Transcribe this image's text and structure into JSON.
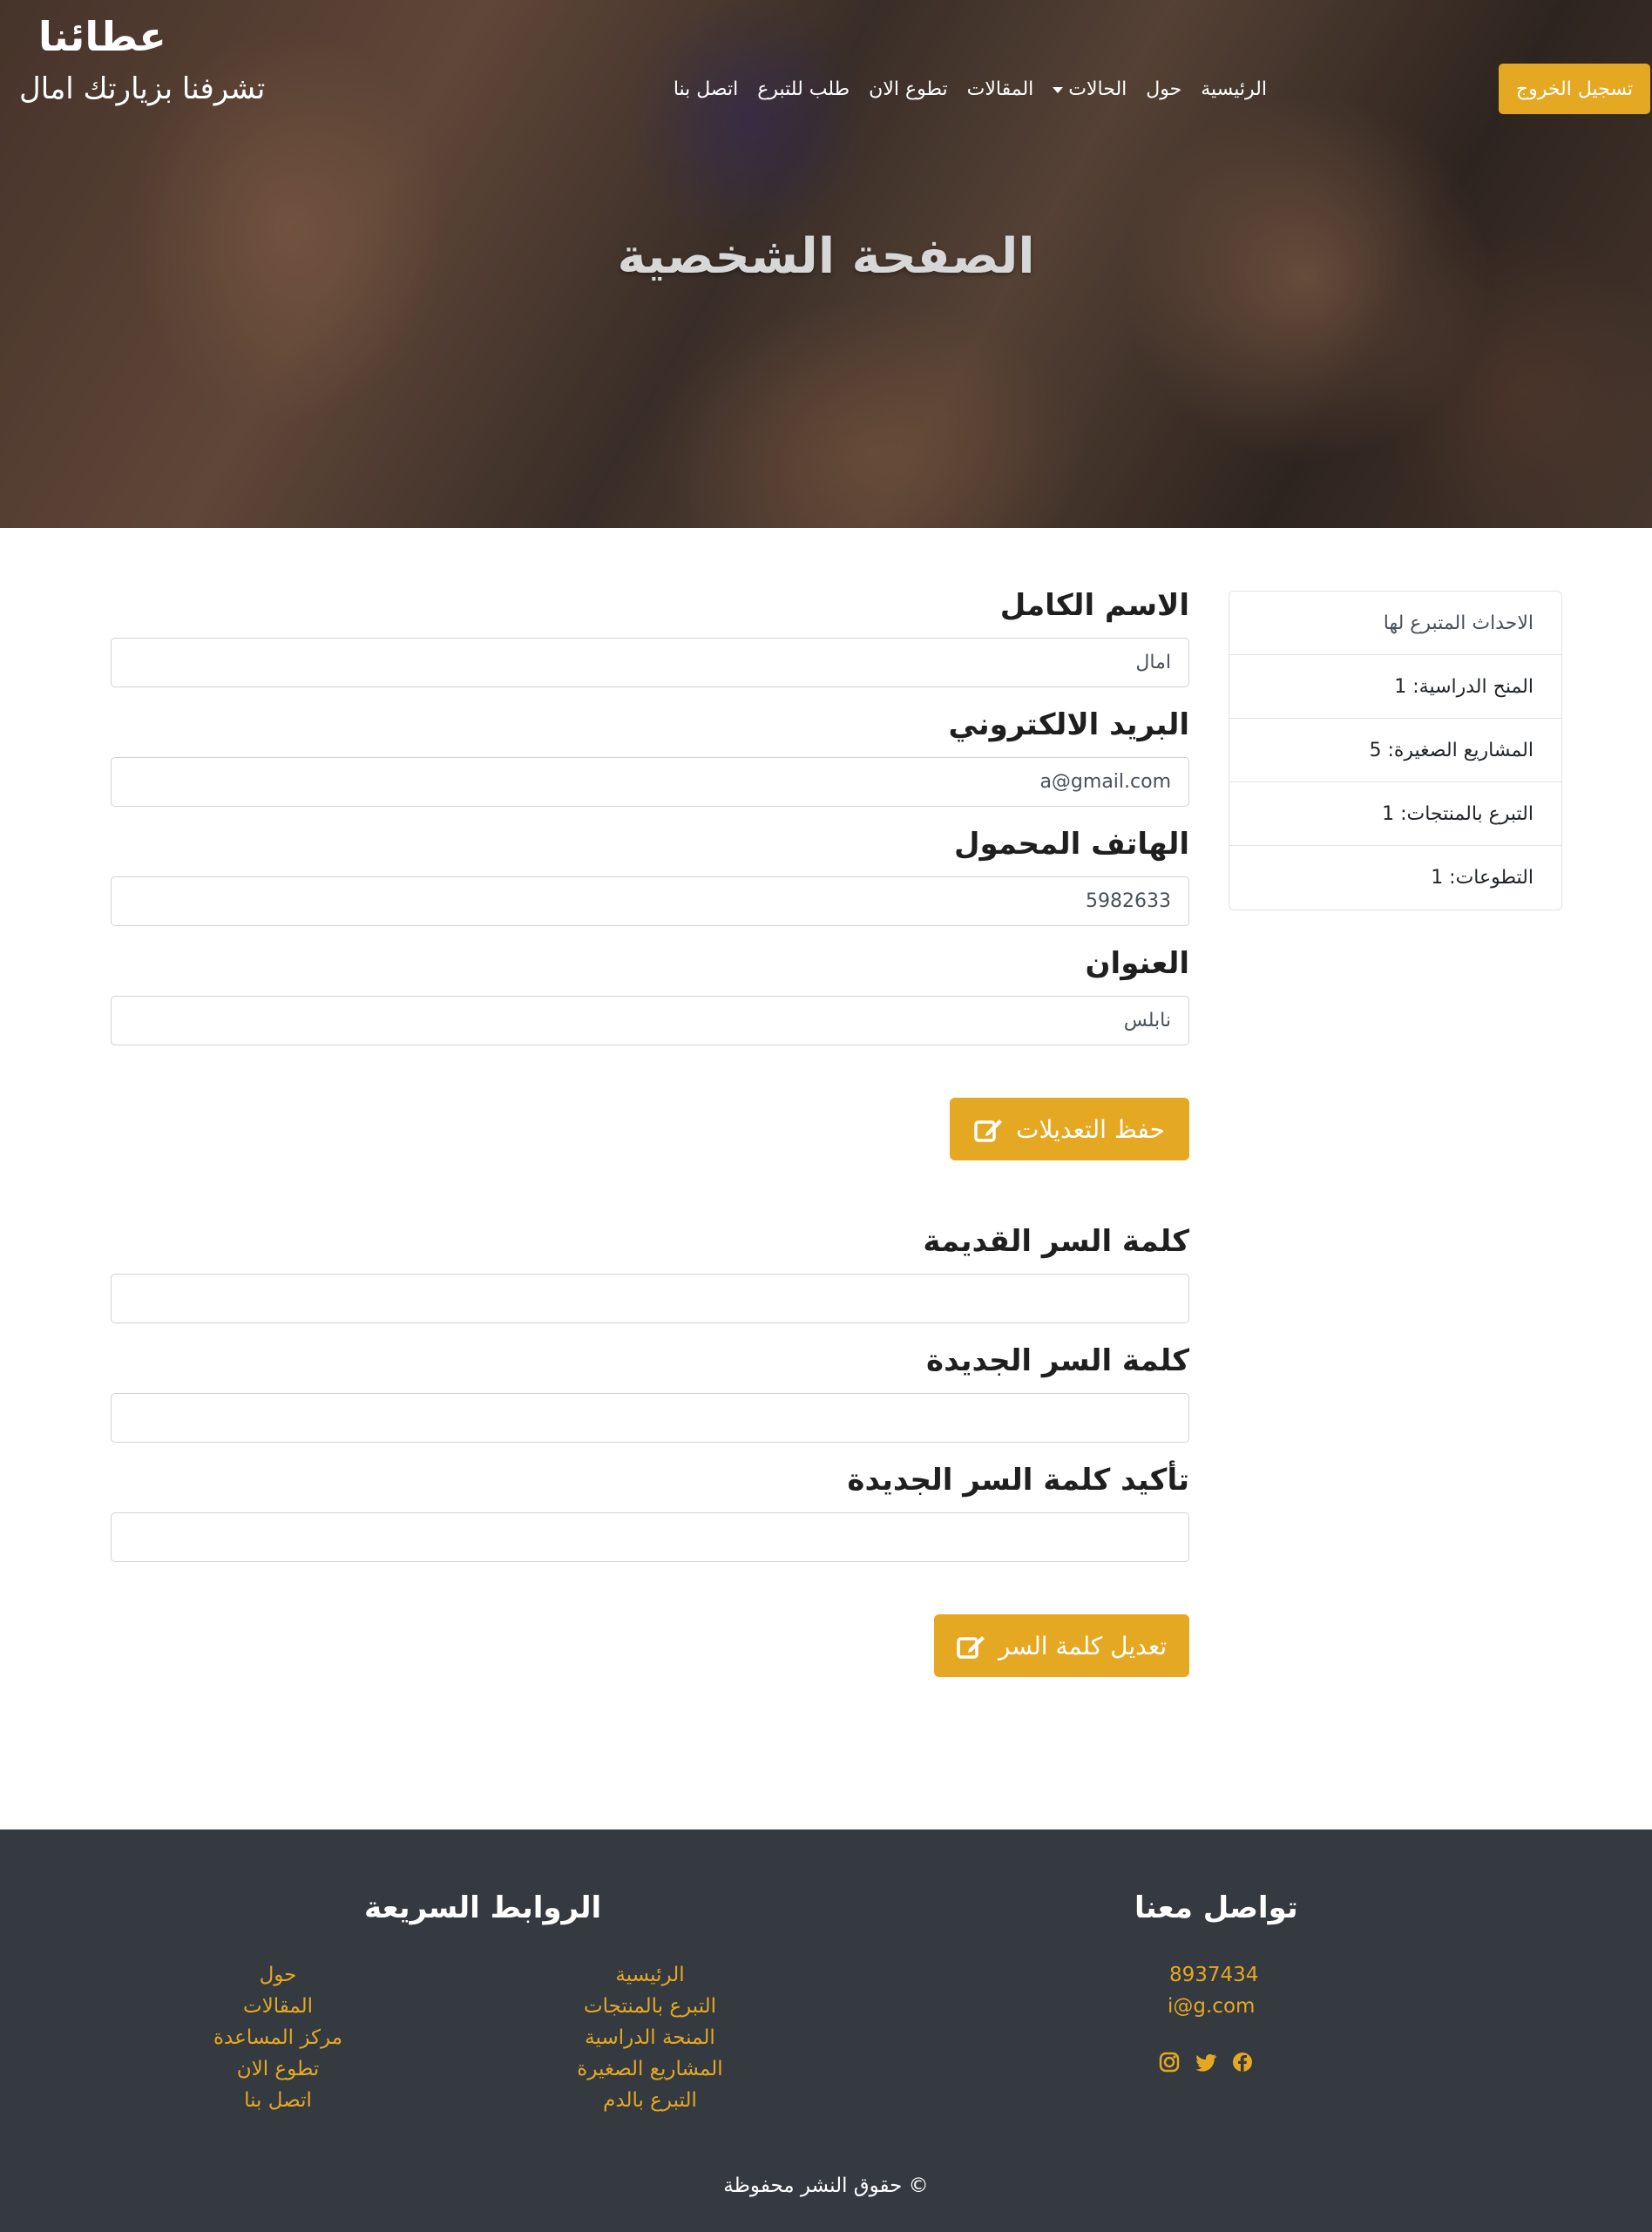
{
  "header": {
    "brand": "عطائنا",
    "welcome": "تشرفنا بزيارتك امال",
    "logout_label": "تسجيل الخروج",
    "nav": {
      "home": "الرئيسية",
      "about": "حول",
      "cases": "الحالات",
      "articles": "المقالات",
      "volunteer": "تطوع الان",
      "request_donation": "طلب للتبرع",
      "contact": "اتصل بنا"
    },
    "page_title": "الصفحة الشخصية"
  },
  "stats": {
    "header": "الاحداث المتبرع لها",
    "scholarships": "المنح الدراسية: 1",
    "small_projects": "المشاريع الصغيرة: 5",
    "products": "التبرع بالمنتجات: 1",
    "volunteering": "التطوعات: 1"
  },
  "profile_form": {
    "name_label": "الاسم الكامل",
    "name_value": "امال",
    "email_label": "البريد الالكتروني",
    "email_value": "a@gmail.com",
    "phone_label": "الهاتف المحمول",
    "phone_value": "5982633",
    "address_label": "العنوان",
    "address_value": "نابلس",
    "save_label": "حفظ التعديلات"
  },
  "password_form": {
    "old_label": "كلمة السر القديمة",
    "new_label": "كلمة السر الجديدة",
    "confirm_label": "تأكيد كلمة السر الجديدة",
    "submit_label": "تعديل كلمة السر"
  },
  "footer": {
    "contact_title": "تواصل معنا",
    "phone": "8937434",
    "email": "i@g.com",
    "quick_links_title": "الروابط السريعة",
    "links_col1": [
      "الرئيسية",
      "التبرع بالمنتجات",
      "المنحة الدراسية",
      "المشاريع الصغيرة",
      "التبرع بالدم"
    ],
    "links_col2": [
      "حول",
      "المقالات",
      "مركز المساعدة",
      "تطوع الان",
      "اتصل بنا"
    ],
    "copyright": "© حقوق النشر محفوظة",
    "social_icons": [
      "facebook-icon",
      "twitter-icon",
      "instagram-icon"
    ]
  },
  "colors": {
    "accent": "#e5a823",
    "footer_bg": "#343a40"
  }
}
